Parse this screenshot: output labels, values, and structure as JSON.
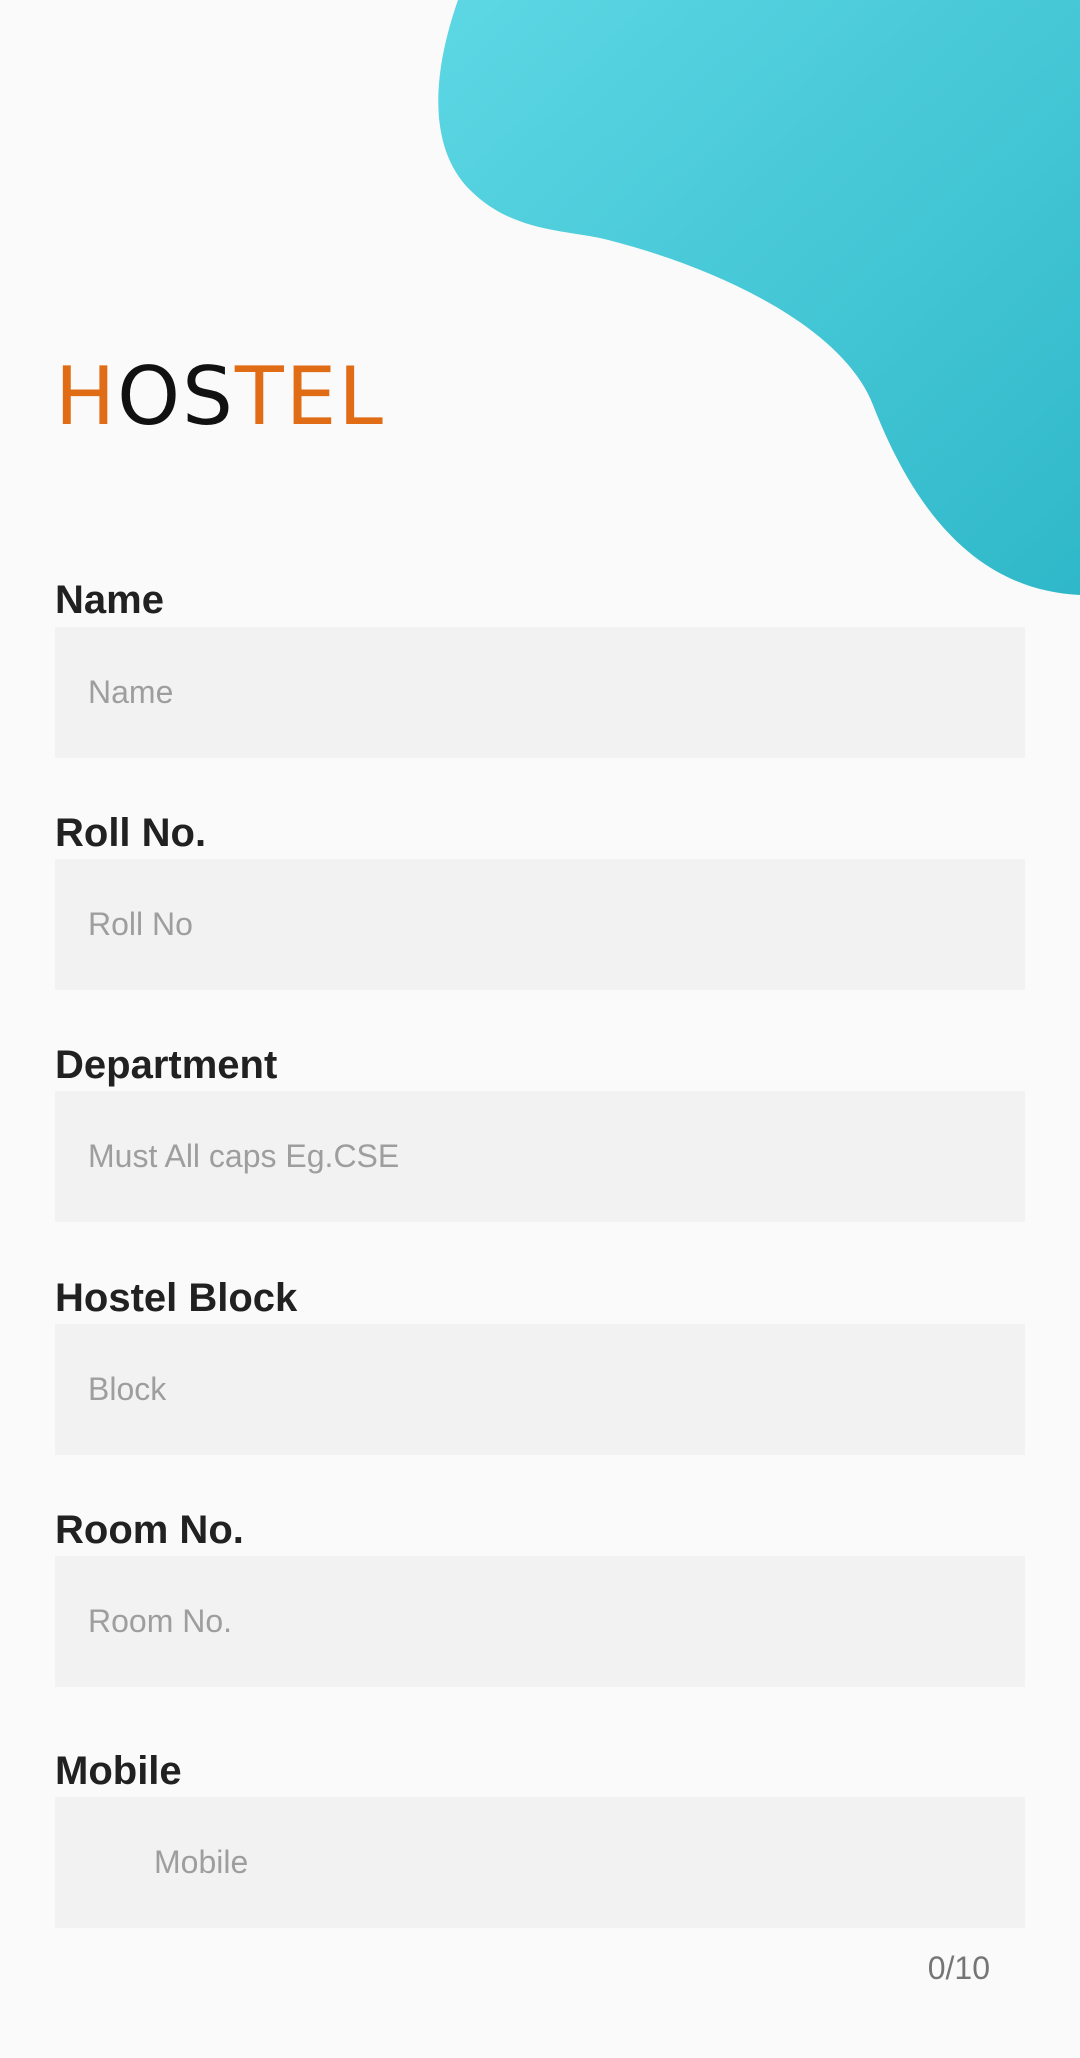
{
  "header": {
    "logo_letters": [
      "H",
      "O",
      "S",
      "T",
      "E",
      "L"
    ],
    "logo_colors": [
      "#e06c15",
      "#111111",
      "#111111",
      "#e06c15",
      "#e06c15",
      "#e06c15"
    ],
    "blob_gradient": [
      "#5dd7e4",
      "#2fb8c9"
    ]
  },
  "form": {
    "name": {
      "label": "Name",
      "placeholder": "Name"
    },
    "roll": {
      "label": "Roll No.",
      "placeholder": "Roll No"
    },
    "department": {
      "label": "Department",
      "placeholder": "Must All caps Eg.CSE"
    },
    "block": {
      "label": "Hostel Block",
      "placeholder": "Block"
    },
    "room": {
      "label": "Room No.",
      "placeholder": "Room No."
    },
    "mobile": {
      "label": "Mobile",
      "placeholder": "Mobile",
      "counter": "0/10"
    }
  }
}
